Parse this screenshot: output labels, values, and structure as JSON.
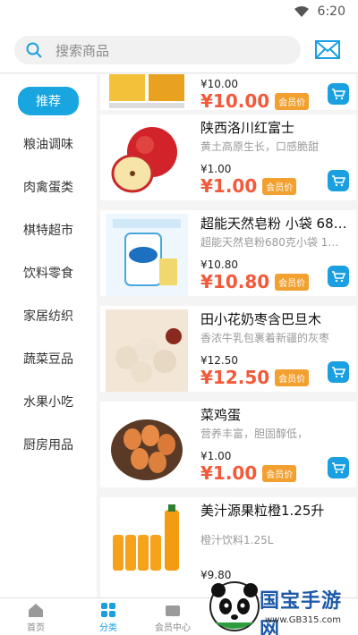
{
  "status_bar": {
    "time": "6:20"
  },
  "header": {
    "search_placeholder": "搜索商品"
  },
  "sidebar": {
    "items": [
      {
        "label": "推荐",
        "active": true
      },
      {
        "label": "粮油调味"
      },
      {
        "label": "肉禽蛋类"
      },
      {
        "label": "棋特超市"
      },
      {
        "label": "饮料零食"
      },
      {
        "label": "家居纺织"
      },
      {
        "label": "蔬菜豆品"
      },
      {
        "label": "水果小吃"
      },
      {
        "label": "厨房用品"
      }
    ]
  },
  "products": [
    {
      "name": "",
      "desc": "",
      "price": "¥10.00",
      "member_price": "¥10.00",
      "badge": "会员价"
    },
    {
      "name": "陕西洛川红富士",
      "desc": "黄土高原生长，口感脆甜",
      "price": "¥1.00",
      "member_price": "¥1.00",
      "badge": "会员价"
    },
    {
      "name": "超能天然皂粉 小袋 680g",
      "desc": "超能天然皂粉680克小袋 1…",
      "price": "¥10.80",
      "member_price": "¥10.80",
      "badge": "会员价"
    },
    {
      "name": "田小花奶枣含巴旦木",
      "desc": "香浓牛乳包裹着新疆的灰枣",
      "price": "¥12.50",
      "member_price": "¥12.50",
      "badge": "会员价"
    },
    {
      "name": "菜鸡蛋",
      "desc": "营养丰富，胆固醇低，",
      "price": "¥1.00",
      "member_price": "¥1.00",
      "badge": "会员价"
    },
    {
      "name": "美汁源果粒橙1.25升",
      "desc": "橙汁饮料1.25L",
      "price": "¥9.80",
      "member_price": "",
      "badge": ""
    }
  ],
  "bottom_nav": [
    {
      "label": "首页"
    },
    {
      "label": "分类",
      "active": true
    },
    {
      "label": "会员中心"
    }
  ],
  "watermark": {
    "title": "国宝手游网",
    "url": "www.GB315.com"
  },
  "colors": {
    "accent": "#1aa0e0",
    "price": "#f25a3b",
    "badge": "#f2a030"
  }
}
